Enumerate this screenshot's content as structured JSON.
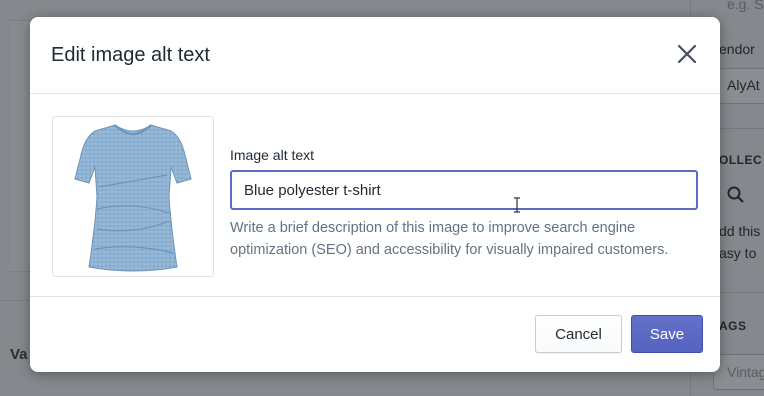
{
  "background": {
    "left_heading": "Va",
    "sidebar": {
      "placeholder_top": "e.g. S",
      "vendor_label": "endor",
      "vendor_value": "AlyAt",
      "collections_heading": "OLLEC",
      "collections_help_1": "dd this",
      "collections_help_2": "asy to",
      "tags_heading": "AGS",
      "tags_placeholder": "Vintag"
    }
  },
  "modal": {
    "title": "Edit image alt text",
    "close_icon": "close-icon",
    "image": {
      "icon": "tshirt-image",
      "color": "#8fb3d4"
    },
    "field_label": "Image alt text",
    "alt_input_value": "Blue polyester t-shirt",
    "help_text": "Write a brief description of this image to improve search engine optimization (SEO) and accessibility for visually impaired customers.",
    "footer": {
      "cancel_label": "Cancel",
      "save_label": "Save"
    }
  },
  "colors": {
    "primary": "#5c6ac4",
    "overlay": "#7c7f84"
  }
}
